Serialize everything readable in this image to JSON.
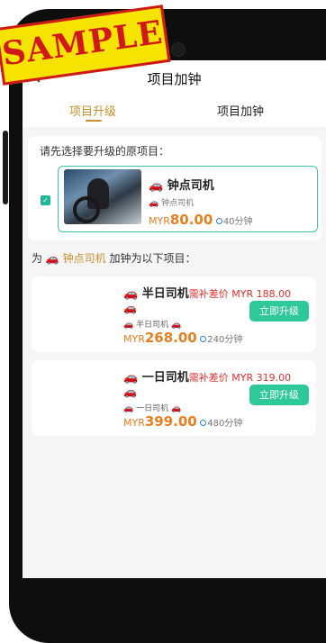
{
  "watermark": "SAMPLE",
  "header": {
    "title": "项目加钟",
    "back_icon": "back-arrow-icon"
  },
  "tabs": [
    {
      "label": "项目升级",
      "active": true
    },
    {
      "label": "项目加钟",
      "active": false
    }
  ],
  "selection": {
    "prompt": "请先选择要升级的原项目：",
    "item": {
      "name": "钟点司机",
      "sub": "钟点司机",
      "currency": "MYR",
      "price": "80.00",
      "duration": "40分钟",
      "checked": true
    }
  },
  "for_line": {
    "prefix": "为",
    "name": "钟点司机",
    "suffix": "加钟为以下项目："
  },
  "options": [
    {
      "name": "半日司机",
      "diff_text": "需补差价 MYR 188.00",
      "sub": "半日司机",
      "currency": "MYR",
      "price": "268.00",
      "duration": "240分钟",
      "button": "立即升级"
    },
    {
      "name": "一日司机",
      "diff_text": "需补差价 MYR 319.00",
      "sub": "一日司机",
      "currency": "MYR",
      "price": "399.00",
      "duration": "480分钟",
      "button": "立即升级"
    }
  ],
  "colors": {
    "accent": "#c8902c",
    "primary_button": "#2ec89a",
    "price": "#e67e22",
    "diff": "#e0302a",
    "selected_border": "#3cc3a4"
  }
}
